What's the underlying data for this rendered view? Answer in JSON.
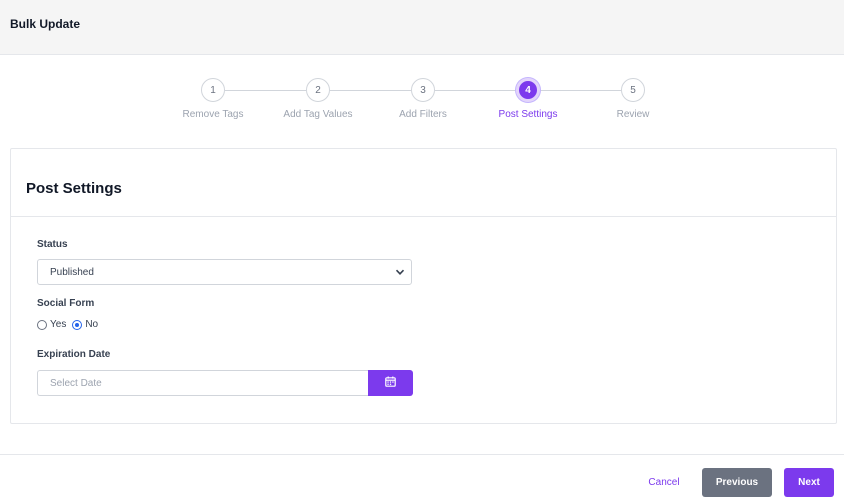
{
  "header": {
    "title": "Bulk Update"
  },
  "stepper": {
    "steps": [
      {
        "number": "1",
        "label": "Remove Tags"
      },
      {
        "number": "2",
        "label": "Add Tag Values"
      },
      {
        "number": "3",
        "label": "Add Filters"
      },
      {
        "number": "4",
        "label": "Post Settings"
      },
      {
        "number": "5",
        "label": "Review"
      }
    ],
    "active_step": 4
  },
  "card": {
    "title": "Post Settings",
    "status": {
      "label": "Status",
      "value": "Published"
    },
    "social_form": {
      "label": "Social Form",
      "options": [
        "Yes",
        "No"
      ],
      "selected": "No"
    },
    "expiration": {
      "label": "Expiration Date",
      "placeholder": "Select Date"
    }
  },
  "footer": {
    "cancel_label": "Cancel",
    "previous_label": "Previous",
    "next_label": "Next"
  },
  "colors": {
    "accent": "#7c3aed",
    "secondary_button": "#6b7280"
  },
  "icons": {
    "status_dropdown": "chevron-down-icon",
    "date_picker": "calendar-icon"
  }
}
